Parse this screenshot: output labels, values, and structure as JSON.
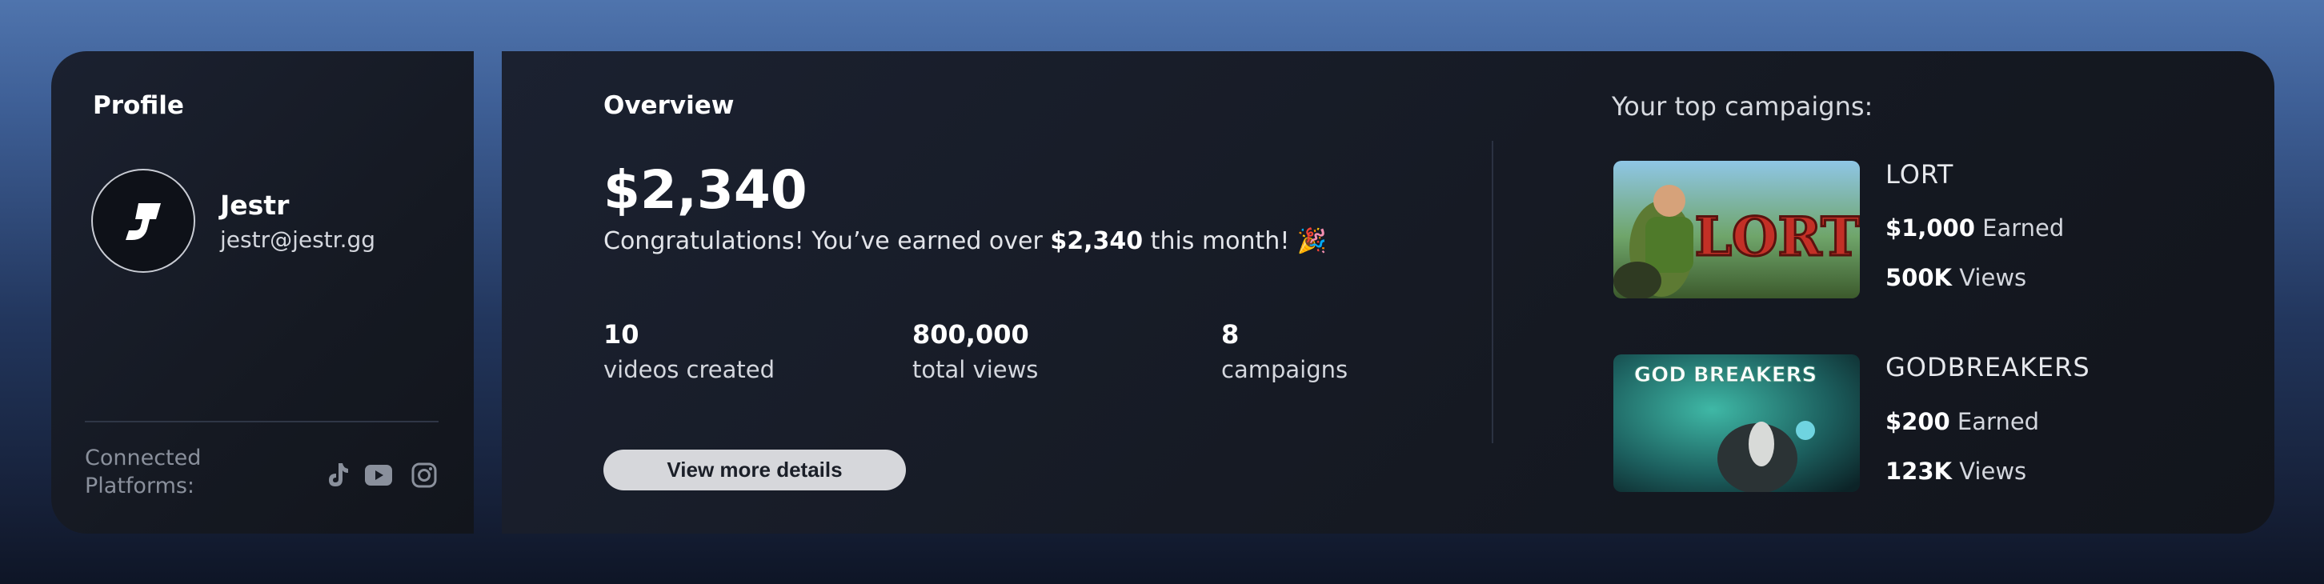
{
  "profile": {
    "title": "Profile",
    "name": "Jestr",
    "email": "jestr@jestr.gg",
    "connected_label": "Connected Platforms:",
    "platforms": [
      "tiktok-icon",
      "youtube-icon",
      "instagram-icon"
    ]
  },
  "overview": {
    "title": "Overview",
    "amount": "$2,340",
    "congrats_prefix": "Congratulations! You’ve earned over ",
    "congrats_amount": "$2,340",
    "congrats_suffix": " this month! 🎉",
    "stats": [
      {
        "value": "10",
        "label": "videos created"
      },
      {
        "value": "800,000",
        "label": "total views"
      },
      {
        "value": "8",
        "label": "campaigns"
      }
    ],
    "button_label": "View more details"
  },
  "campaigns": {
    "title": "Your top campaigns:",
    "items": [
      {
        "name": "LORT",
        "earned_value": "$1,000",
        "earned_label": " Earned",
        "views_value": "500K",
        "views_label": " Views",
        "thumb_text": "LORT"
      },
      {
        "name": "GODBREAKERS",
        "earned_value": "$200",
        "earned_label": " Earned",
        "views_value": "123K",
        "views_label": " Views",
        "thumb_text": "GOD BREAKERS"
      }
    ]
  },
  "colors": {
    "panel": "#161a23",
    "button": "#d6d7db",
    "accent_text": "#ffffff"
  }
}
